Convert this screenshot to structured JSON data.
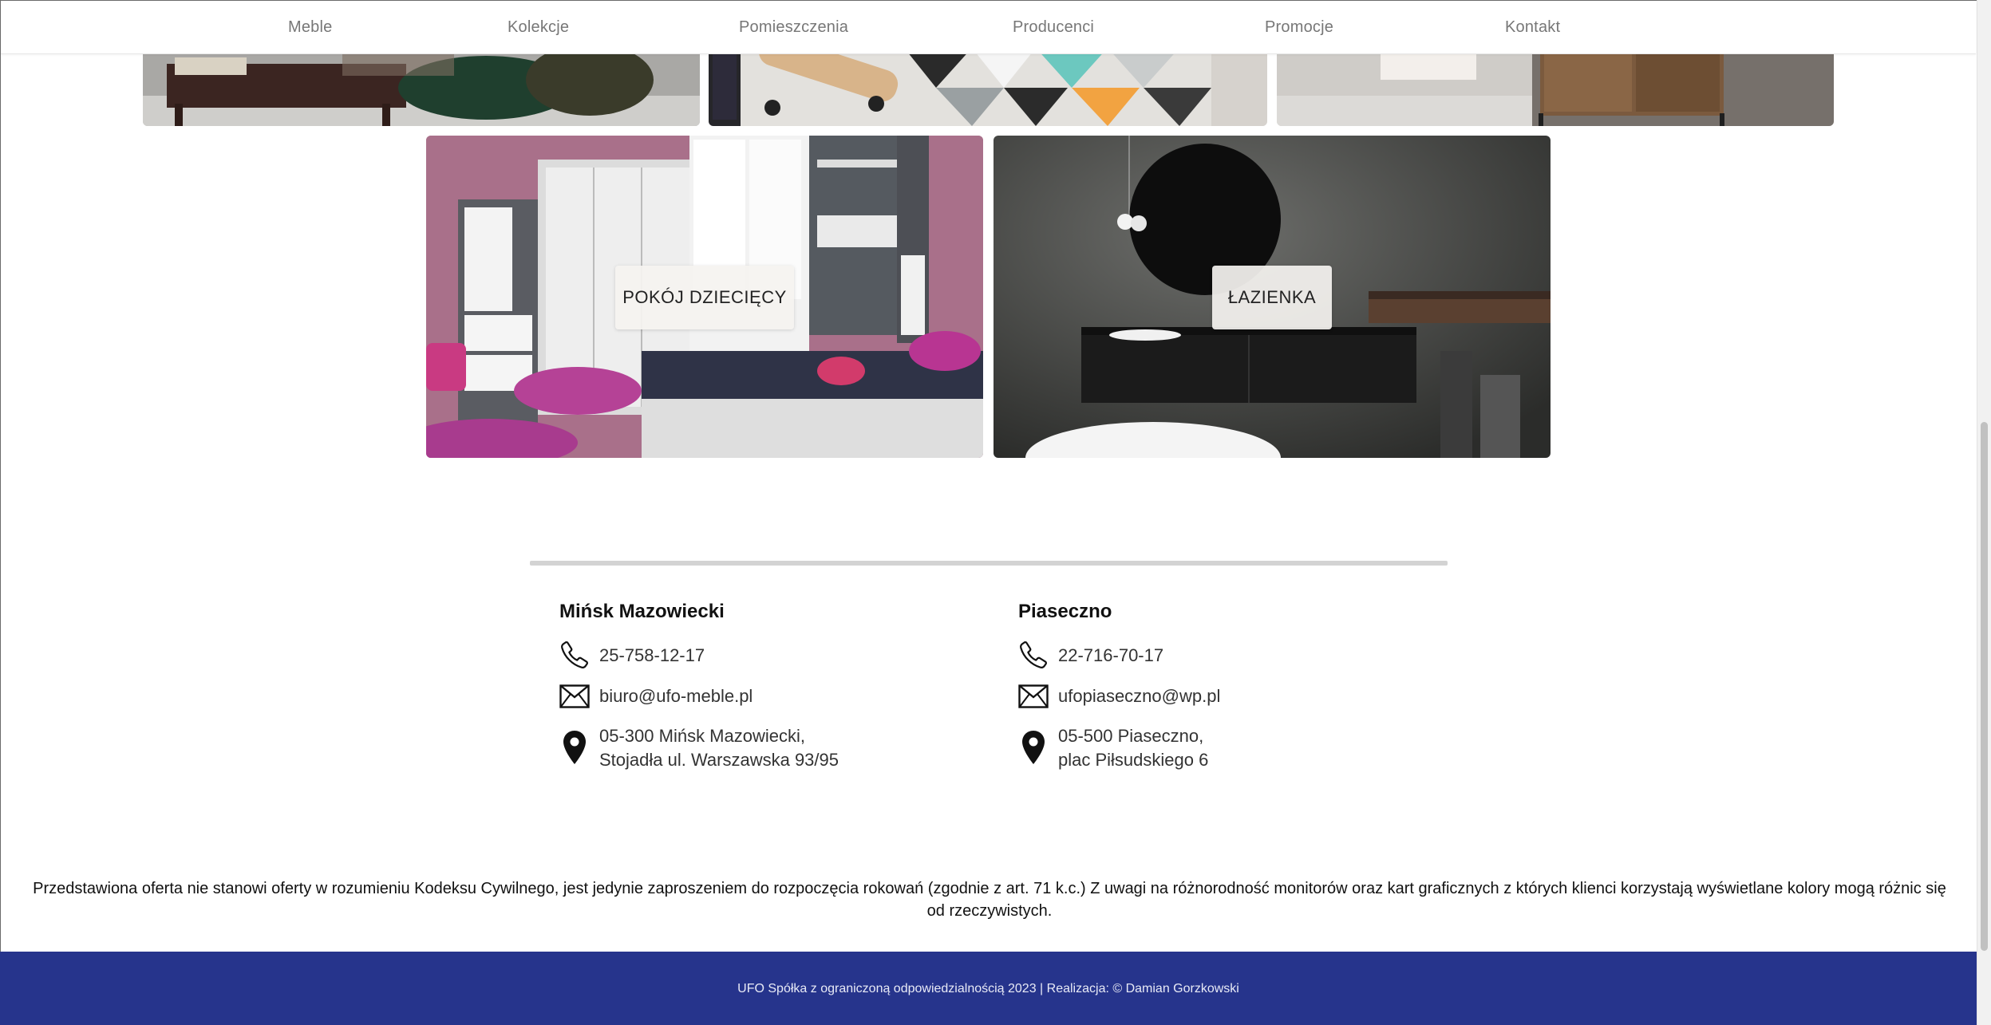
{
  "nav": {
    "items": [
      "Meble",
      "Kolekcje",
      "Pomieszczenia",
      "Producenci",
      "Promocje",
      "Kontakt"
    ]
  },
  "rooms": {
    "kids_room": "POKÓJ DZIECIĘCY",
    "bathroom": "ŁAZIENKA"
  },
  "branches": [
    {
      "name": "Mińsk Mazowiecki",
      "phone": "25-758-12-17",
      "email": "biuro@ufo-meble.pl",
      "address_line1": "05-300 Mińsk Mazowiecki,",
      "address_line2": "Stojadła ul. Warszawska 93/95"
    },
    {
      "name": "Piaseczno",
      "phone": "22-716-70-17",
      "email": "ufopiaseczno@wp.pl",
      "address_line1": "05-500 Piaseczno,",
      "address_line2": "plac Piłsudskiego 6"
    }
  ],
  "disclaimer": "Przedstawiona oferta nie stanowi oferty w rozumieniu Kodeksu Cywilnego, jest jedynie zaproszeniem do rozpoczęcia rokowań (zgodnie z art. 71 k.c.) Z uwagi na różnorodność monitorów oraz kart graficznych z których klienci korzystają wyświetlane kolory mogą różnic się od rzeczywistych.",
  "footer": {
    "copyright": "UFO Spółka z ograniczoną odpowiedzialnością 2023 | Realizacja: © Damian Gorzkowski"
  },
  "colors": {
    "footer_bg": "#26348c",
    "divider": "#d3d3d3"
  },
  "icons": [
    "phone-icon",
    "envelope-icon",
    "map-pin-icon"
  ]
}
